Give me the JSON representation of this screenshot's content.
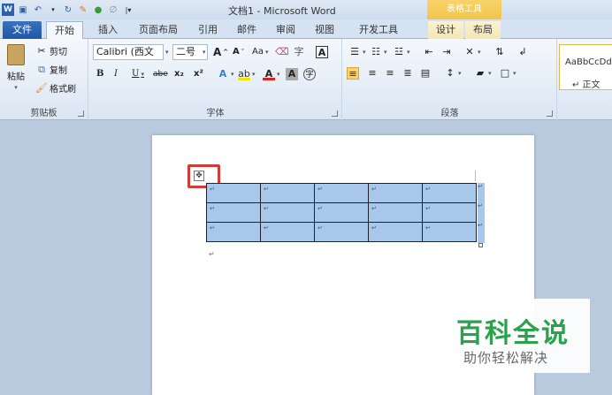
{
  "window": {
    "title": "文档1 - Microsoft Word",
    "context_title": "表格工具"
  },
  "qat": {
    "icons": [
      "word-logo-icon",
      "save-icon",
      "undo-icon",
      "redo-icon",
      "format-painter-icon",
      "spell-icon",
      "customize-icon"
    ]
  },
  "tabs": [
    {
      "label": "文件"
    },
    {
      "label": "开始"
    },
    {
      "label": "插入"
    },
    {
      "label": "页面布局"
    },
    {
      "label": "引用"
    },
    {
      "label": "邮件"
    },
    {
      "label": "审阅"
    },
    {
      "label": "视图"
    },
    {
      "label": "开发工具"
    },
    {
      "label": "设计"
    },
    {
      "label": "布局"
    }
  ],
  "ribbon": {
    "clipboard": {
      "paste": "粘贴",
      "cut": "剪切",
      "copy": "复制",
      "format_painter": "格式刷",
      "group_label": "剪贴板"
    },
    "font": {
      "font_name": "Calibri (西文",
      "font_size": "二号",
      "grow": "A",
      "shrink": "A",
      "change_case": "Aa",
      "bold": "B",
      "italic": "I",
      "underline": "U",
      "strikethrough": "abe",
      "subscript": "x₂",
      "superscript": "x²",
      "group_label": "字体"
    },
    "paragraph": {
      "group_label": "段落"
    },
    "styles": {
      "sample": "AaBbCcDd",
      "name": "↵ 正文"
    }
  },
  "document": {
    "move_handle": "✥",
    "rows": [
      [
        "↵",
        "↵",
        "↵",
        "↵",
        "↵"
      ],
      [
        "↵",
        "↵",
        "↵",
        "↵",
        "↵"
      ],
      [
        "↵",
        "↵",
        "↵",
        "↵",
        "↵"
      ]
    ],
    "row_end_marks": [
      "↵",
      "↵",
      "↵"
    ],
    "paragraph_mark": "↵"
  },
  "watermark": {
    "title": "百科全说",
    "subtitle": "助你轻松解决"
  },
  "colors": {
    "file_tab": "#2a62b4",
    "table_selection": "#a7c8ea",
    "highlight": "#d63a35",
    "watermark_green": "#2aa24b"
  }
}
